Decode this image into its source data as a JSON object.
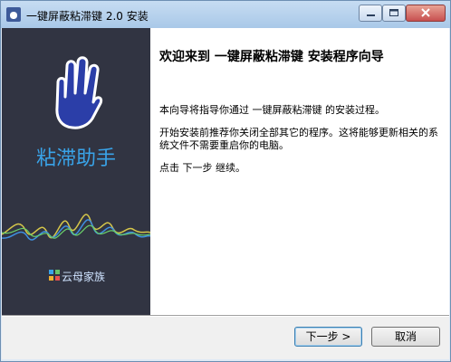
{
  "window": {
    "title": "一键屏蔽粘滞键 2.0 安装",
    "icon": "app-icon",
    "controls": [
      "minimize-icon",
      "maximize-icon",
      "close-icon"
    ]
  },
  "sidebar": {
    "title": "粘滞助手",
    "logo_icon": "hand-icon",
    "brand": "云母家族",
    "colors": {
      "background": "#313442",
      "accent": "#39a3e8"
    }
  },
  "main": {
    "heading": "欢迎来到 一键屏蔽粘滞键 安装程序向导",
    "paragraph1": "本向导将指导你通过 一键屏蔽粘滞键 的安装过程。",
    "paragraph2": "开始安装前推荐你关闭全部其它的程序。这将能够更新相关的系统文件不需要重启你的电脑。",
    "paragraph3": "点击 下一步 继续。"
  },
  "buttons": {
    "next": "下一步 >",
    "cancel": "取消"
  }
}
